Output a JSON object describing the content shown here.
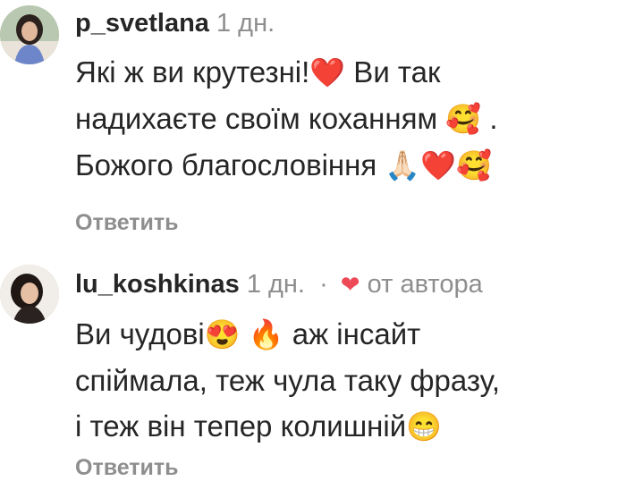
{
  "comments": [
    {
      "username": "p_svetlana",
      "time": "1 дн.",
      "text_lines": [
        [
          "Які ж ви крутезні!",
          "heart-emoji",
          " Ви так"
        ],
        [
          "надихаєте своїм коханням ",
          "smiling-face-with-hearts-emoji",
          " ."
        ],
        [
          "Божого благословіння ",
          "folded-hands-emoji",
          "heart-emoji",
          "smiling-face-with-hearts-emoji"
        ]
      ],
      "reply_label": "Ответить"
    },
    {
      "username": "lu_koshkinas",
      "time": "1 дн.",
      "separator": "·",
      "author_heart": "heart-icon",
      "author_label": "от автора",
      "text_lines": [
        [
          "Ви чудові",
          "heart-eyes-emoji",
          " ",
          "fire-emoji",
          " аж інсайт"
        ],
        [
          "спіймала, теж чула таку фразу,"
        ],
        [
          "і теж він тепер колишній",
          "grinning-emoji"
        ]
      ],
      "reply_label": "Ответить"
    }
  ],
  "emoji_glyphs": {
    "heart-emoji": "❤️",
    "smiling-face-with-hearts-emoji": "🥰",
    "folded-hands-emoji": "🙏🏻",
    "heart-eyes-emoji": "😍",
    "fire-emoji": "🔥",
    "grinning-emoji": "😁",
    "heart-icon": "❤"
  },
  "colors": {
    "text": "#262626",
    "secondary": "#8e8e8e",
    "like_red": "#ed4956"
  }
}
